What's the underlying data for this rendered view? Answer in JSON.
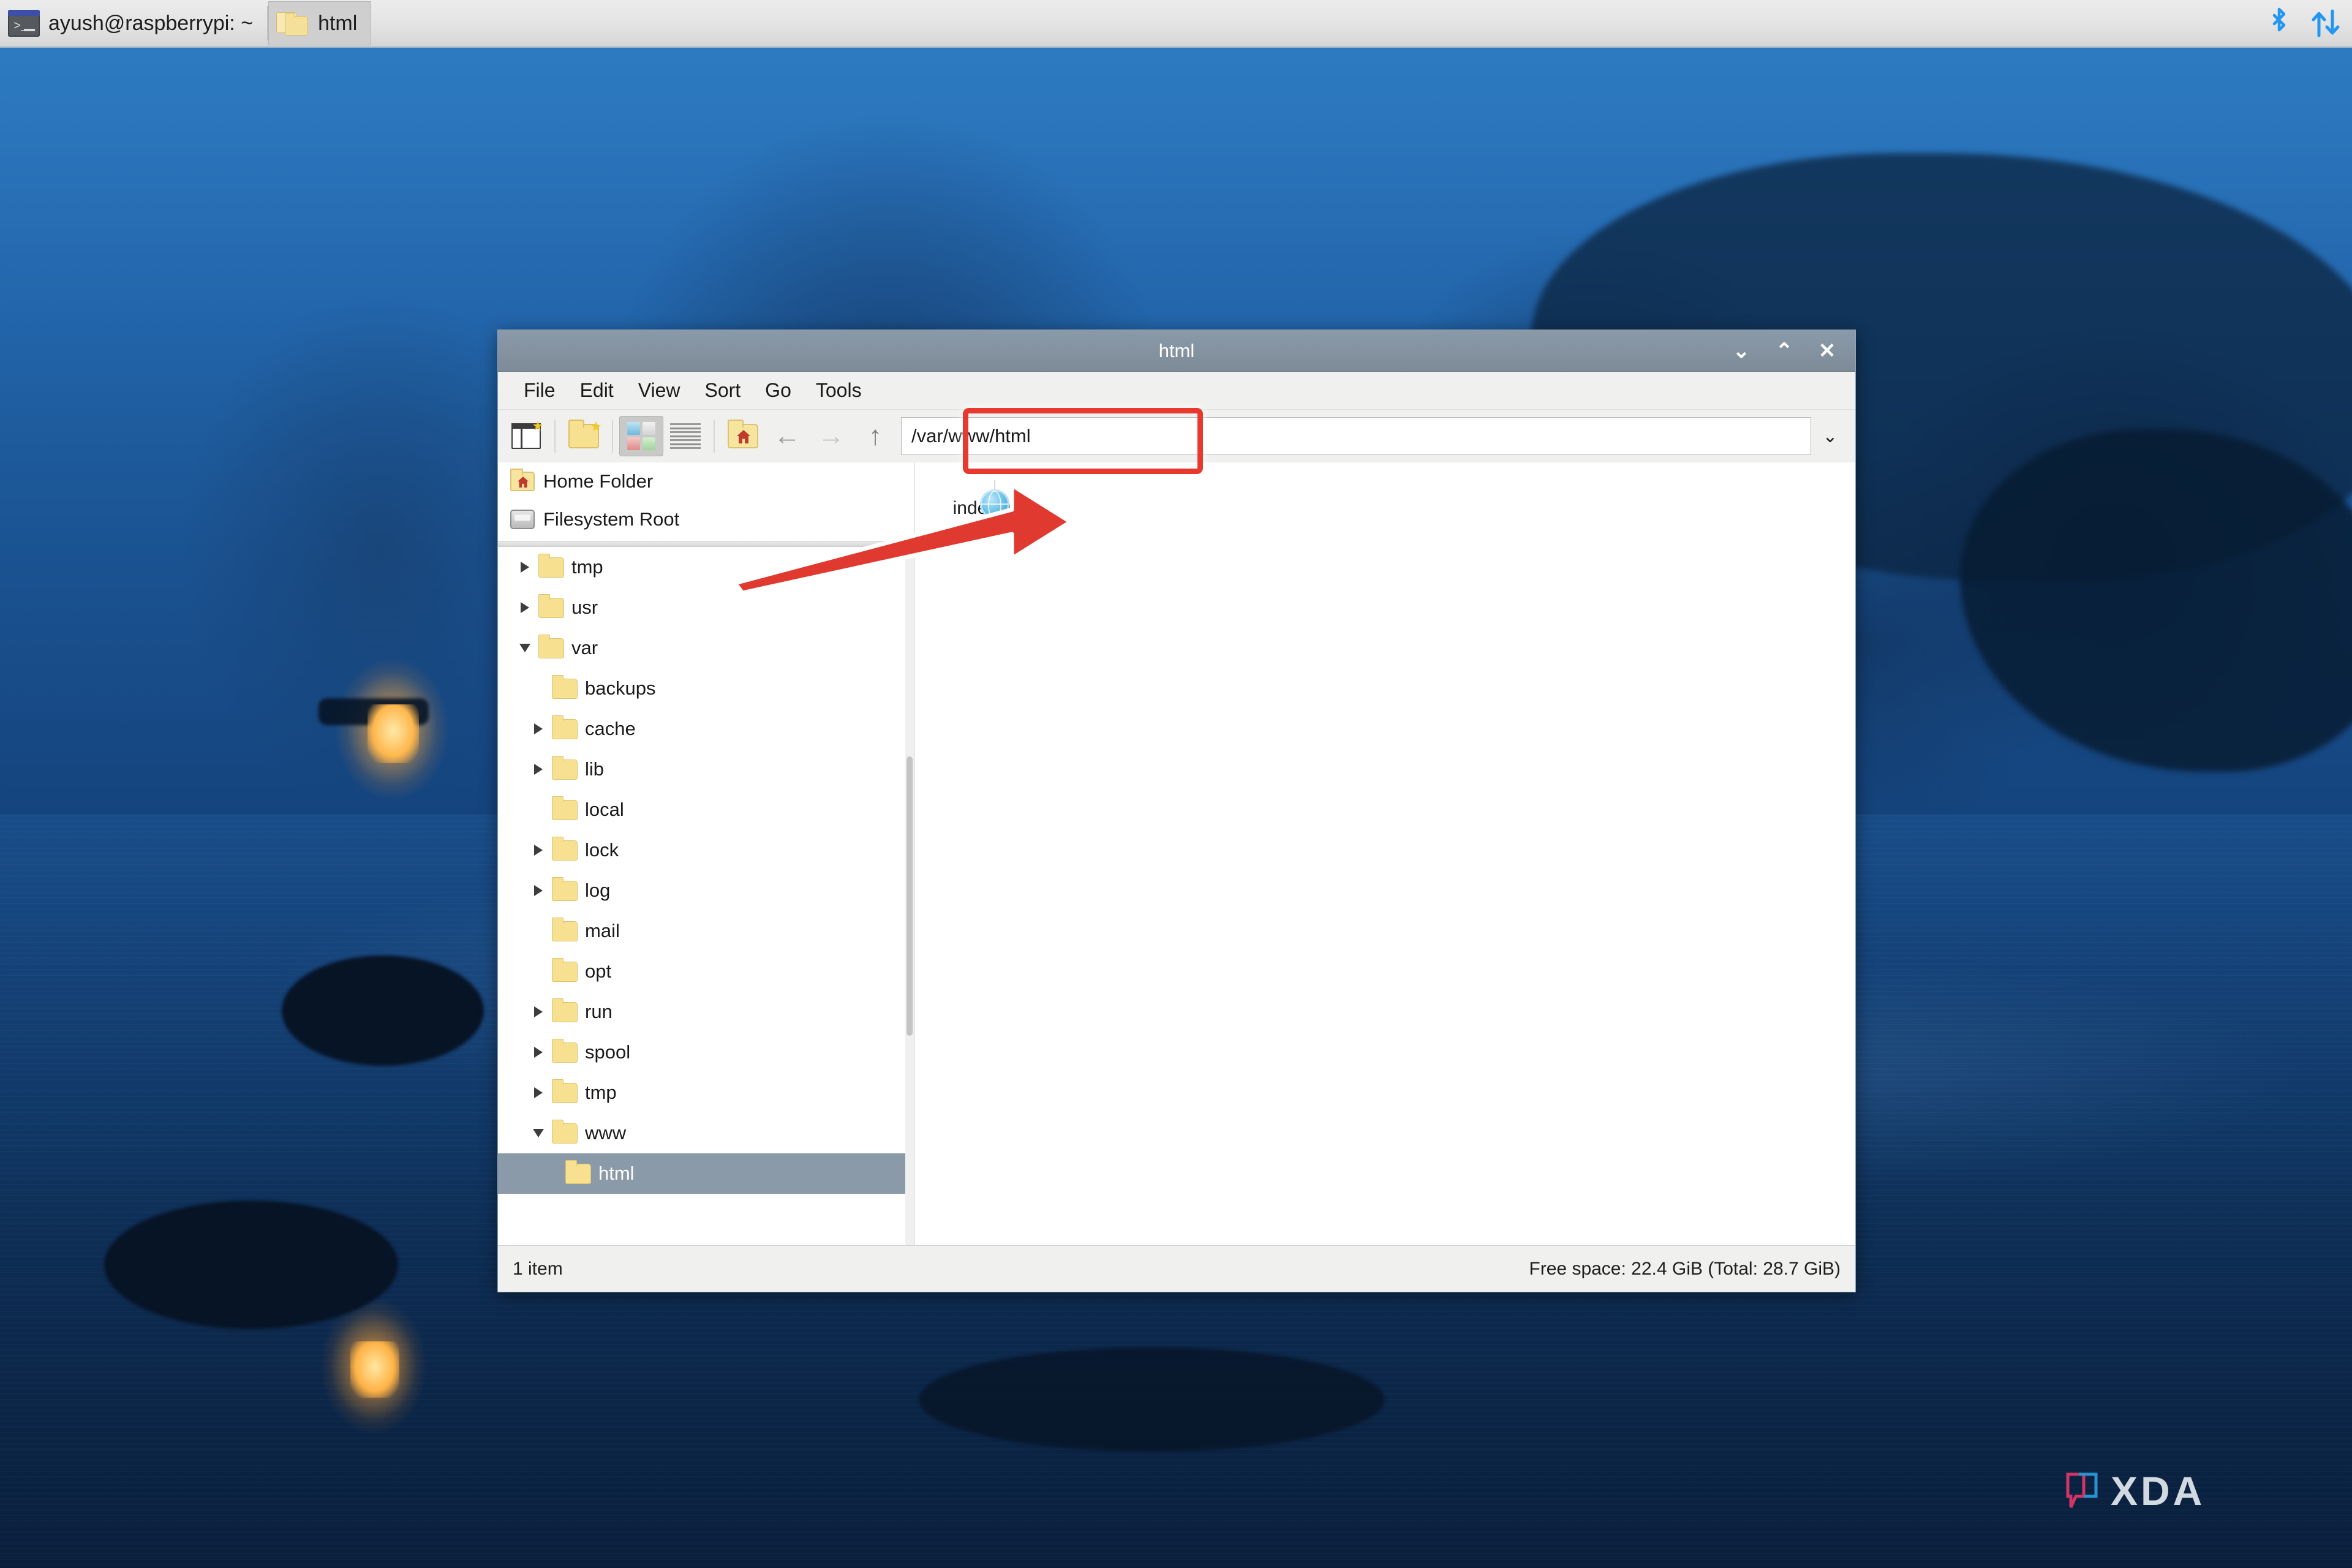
{
  "taskbar": {
    "tasks": [
      {
        "icon": "terminal-icon",
        "label": "ayush@raspberrypi: ~",
        "active": false
      },
      {
        "icon": "file-manager-icon",
        "label": "html",
        "active": true
      }
    ],
    "tray": [
      {
        "icon": "bluetooth-icon",
        "glyph": "ᛦ"
      },
      {
        "icon": "network-updown-icon",
        "glyph": "⇅"
      }
    ]
  },
  "window": {
    "title": "html",
    "controls": {
      "minimize": "⌄",
      "maximize": "⌃",
      "close": "✕"
    },
    "menu": [
      "File",
      "Edit",
      "View",
      "Sort",
      "Go",
      "Tools"
    ],
    "toolbar": {
      "new_window": "new-window-icon",
      "new_folder": "new-folder-icon",
      "icon_view": "icon-view-icon",
      "list_view": "detailed-list-view-icon",
      "home": "home-folder-icon",
      "back": "←",
      "forward": "→",
      "up": "↑",
      "path_value": "/var/www/html",
      "path_placeholder": "/var/www/html",
      "dropdown": "⌄"
    },
    "sidebar": {
      "places": [
        {
          "icon": "home-folder-icon",
          "label": "Home Folder"
        },
        {
          "icon": "disk-icon",
          "label": "Filesystem Root"
        }
      ],
      "tree": [
        {
          "label": "tmp",
          "state": "collapsed",
          "indent": 1,
          "selected": false
        },
        {
          "label": "usr",
          "state": "collapsed",
          "indent": 1,
          "selected": false
        },
        {
          "label": "var",
          "state": "expanded",
          "indent": 1,
          "selected": false
        },
        {
          "label": "backups",
          "state": "leaf",
          "indent": 2,
          "selected": false
        },
        {
          "label": "cache",
          "state": "collapsed",
          "indent": 2,
          "selected": false
        },
        {
          "label": "lib",
          "state": "collapsed",
          "indent": 2,
          "selected": false
        },
        {
          "label": "local",
          "state": "leaf",
          "indent": 2,
          "selected": false
        },
        {
          "label": "lock",
          "state": "collapsed",
          "indent": 2,
          "selected": false
        },
        {
          "label": "log",
          "state": "collapsed",
          "indent": 2,
          "selected": false
        },
        {
          "label": "mail",
          "state": "leaf",
          "indent": 2,
          "selected": false
        },
        {
          "label": "opt",
          "state": "leaf",
          "indent": 2,
          "selected": false
        },
        {
          "label": "run",
          "state": "collapsed",
          "indent": 2,
          "selected": false
        },
        {
          "label": "spool",
          "state": "collapsed",
          "indent": 2,
          "selected": false
        },
        {
          "label": "tmp",
          "state": "collapsed",
          "indent": 2,
          "selected": false
        },
        {
          "label": "www",
          "state": "expanded",
          "indent": 2,
          "selected": false
        },
        {
          "label": "html",
          "state": "leaf",
          "indent": 3,
          "selected": true
        }
      ]
    },
    "files": [
      {
        "icon": "html-document-icon",
        "name": "index.html"
      }
    ],
    "status": {
      "items": "1 item",
      "free_space": "Free space: 22.4 GiB (Total: 28.7 GiB)"
    }
  },
  "annotations": {
    "highlight_color": "#e8392e",
    "arrow_color": "#e03a30",
    "target": "/var/www/html"
  },
  "watermark": {
    "text": "XDA"
  }
}
